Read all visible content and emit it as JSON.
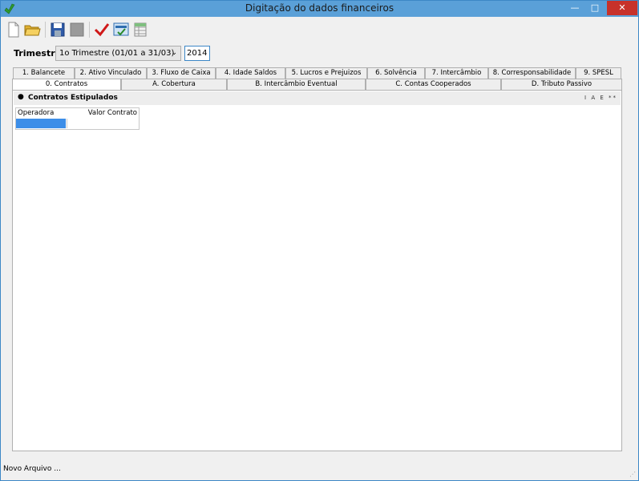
{
  "window": {
    "title": "Digitação do dados financeiros"
  },
  "toolbar": {
    "buttons": [
      "new-file-icon",
      "open-folder-icon",
      "save-icon",
      "disabled-icon",
      "checkmark-icon",
      "calculator-icon",
      "grid-report-icon"
    ]
  },
  "filter": {
    "trimestre_label": "Trimestre",
    "trimestre_value": "1o Trimestre (01/01 a 31/03)",
    "year_value": "2014"
  },
  "tabs_row1": [
    "1. Balancete",
    "2. Ativo Vinculado",
    "3. Fluxo de Caixa",
    "4. Idade Saldos",
    "5. Lucros e Prejuizos",
    "6. Solvência",
    "7. Intercâmbio",
    "8. Corresponsabilidade",
    "9. SPESL"
  ],
  "tabs_row2": [
    "0. Contratos",
    "A. Cobertura",
    "B. Intercâmbio Eventual",
    "C. Contas Cooperados",
    "D. Tributo Passivo"
  ],
  "active_tab": "0. Contratos",
  "section": {
    "title": "Contratos Estipulados",
    "header_icons": "I A E **"
  },
  "grid": {
    "columns": [
      "Operadora",
      "Valor Contrato"
    ],
    "selected_color": "#3d8ee8"
  },
  "status": {
    "text": "Novo Arquivo ..."
  }
}
